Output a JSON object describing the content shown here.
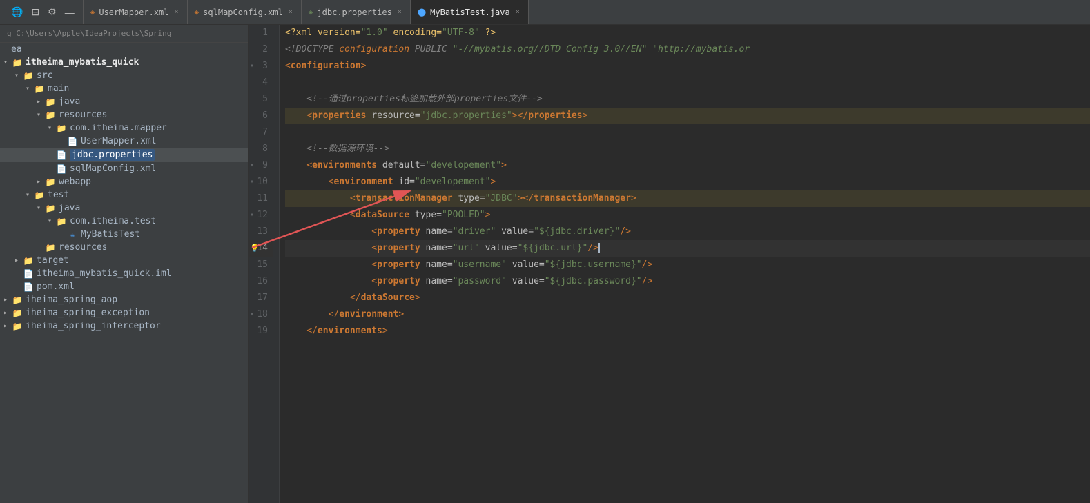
{
  "tabBar": {
    "tabs": [
      {
        "id": "usermapper",
        "label": "UserMapper.xml",
        "type": "xml",
        "active": false
      },
      {
        "id": "sqlmapconfig",
        "label": "sqlMapConfig.xml",
        "type": "xml",
        "active": false
      },
      {
        "id": "jdbc",
        "label": "jdbc.properties",
        "type": "properties",
        "active": false
      },
      {
        "id": "mybatistest",
        "label": "MyBatisTest.java",
        "type": "java",
        "active": true
      }
    ],
    "closeLabel": "×"
  },
  "sidebar": {
    "path": "g C:\\Users\\Apple\\IdeaProjects\\Spring",
    "topLabel": "ea",
    "items": [
      {
        "id": "itheima-mybatis",
        "label": "itheima_mybatis_quick",
        "level": 0,
        "type": "folder",
        "open": true,
        "bold": true
      },
      {
        "id": "src",
        "label": "src",
        "level": 1,
        "type": "folder",
        "open": true
      },
      {
        "id": "main",
        "label": "main",
        "level": 2,
        "type": "folder",
        "open": true
      },
      {
        "id": "java1",
        "label": "java",
        "level": 3,
        "type": "folder",
        "open": false
      },
      {
        "id": "resources",
        "label": "resources",
        "level": 3,
        "type": "folder",
        "open": true
      },
      {
        "id": "com-itheima-mapper",
        "label": "com.itheima.mapper",
        "level": 4,
        "type": "folder",
        "open": true
      },
      {
        "id": "usermapper-xml",
        "label": "UserMapper.xml",
        "level": 5,
        "type": "xml"
      },
      {
        "id": "jdbc-properties",
        "label": "jdbc.properties",
        "level": 4,
        "type": "properties",
        "selected": true
      },
      {
        "id": "sqlmapconfig-xml",
        "label": "sqlMapConfig.xml",
        "level": 4,
        "type": "xml"
      },
      {
        "id": "webapp",
        "label": "webapp",
        "level": 3,
        "type": "folder",
        "open": false
      },
      {
        "id": "test",
        "label": "test",
        "level": 2,
        "type": "folder",
        "open": true
      },
      {
        "id": "java2",
        "label": "java",
        "level": 3,
        "type": "folder",
        "open": true
      },
      {
        "id": "com-itheima-test",
        "label": "com.itheima.test",
        "level": 4,
        "type": "folder",
        "open": true
      },
      {
        "id": "mybatistest-java",
        "label": "MyBatisTest",
        "level": 5,
        "type": "java"
      },
      {
        "id": "resources2",
        "label": "resources",
        "level": 3,
        "type": "folder"
      },
      {
        "id": "target",
        "label": "target",
        "level": 1,
        "type": "folder",
        "open": false
      },
      {
        "id": "itheima-iml",
        "label": "itheima_mybatis_quick.iml",
        "level": 1,
        "type": "iml"
      },
      {
        "id": "pom-xml",
        "label": "pom.xml",
        "level": 1,
        "type": "xml"
      },
      {
        "id": "itheima-spring-aop",
        "label": "iheima_spring_aop",
        "level": 0,
        "type": "folder"
      },
      {
        "id": "itheima-spring-exception",
        "label": "iheima_spring_exception",
        "level": 0,
        "type": "folder"
      },
      {
        "id": "itheima-spring-interceptor",
        "label": "iheima_spring_interceptor",
        "level": 0,
        "type": "folder"
      }
    ]
  },
  "editor": {
    "filename": "sqlMapConfig.xml",
    "lines": [
      {
        "num": 1,
        "fold": false,
        "highlight": "",
        "content": "<?xml version=\"1.0\" encoding=\"UTF-8\" ?>",
        "tokens": [
          {
            "t": "decl",
            "v": "<?xml version=\"1.0\" encoding=\"UTF-8\" ?>"
          }
        ]
      },
      {
        "num": 2,
        "fold": false,
        "highlight": "",
        "content": "<!DOCTYPE configuration PUBLIC \"-//mybatis.org//DTD Config 3.0//EN\" \"http://mybatis.or"
      },
      {
        "num": 3,
        "fold": true,
        "highlight": "",
        "content": "<configuration>"
      },
      {
        "num": 4,
        "fold": false,
        "highlight": "",
        "content": ""
      },
      {
        "num": 5,
        "fold": false,
        "highlight": "",
        "content": "    <!--通过properties标签加载外部properties文件-->"
      },
      {
        "num": 6,
        "fold": false,
        "highlight": "yellow",
        "content": "    <properties resource=\"jdbc.properties\"></properties>"
      },
      {
        "num": 7,
        "fold": false,
        "highlight": "",
        "content": ""
      },
      {
        "num": 8,
        "fold": false,
        "highlight": "",
        "content": "    <!--数据源环境-->"
      },
      {
        "num": 9,
        "fold": true,
        "highlight": "",
        "content": "    <environments default=\"developement\">"
      },
      {
        "num": 10,
        "fold": true,
        "highlight": "",
        "content": "        <environment id=\"developement\">"
      },
      {
        "num": 11,
        "fold": false,
        "highlight": "yellow",
        "content": "            <transactionManager type=\"JDBC\"></transactionManager>"
      },
      {
        "num": 12,
        "fold": true,
        "highlight": "",
        "content": "            <dataSource type=\"POOLED\">"
      },
      {
        "num": 13,
        "fold": false,
        "highlight": "",
        "content": "                <property name=\"driver\" value=\"${jdbc.driver}\"/>"
      },
      {
        "num": 14,
        "fold": false,
        "highlight": "blue",
        "content": "                <property name=\"url\" value=\"${jdbc.url}\"/>",
        "cursor": true
      },
      {
        "num": 15,
        "fold": false,
        "highlight": "",
        "content": "                <property name=\"username\" value=\"${jdbc.username}\"/>"
      },
      {
        "num": 16,
        "fold": false,
        "highlight": "",
        "content": "                <property name=\"password\" value=\"${jdbc.password}\"/>"
      },
      {
        "num": 17,
        "fold": false,
        "highlight": "",
        "content": "            </dataSource>"
      },
      {
        "num": 18,
        "fold": true,
        "highlight": "",
        "content": "        </environment>"
      },
      {
        "num": 19,
        "fold": false,
        "highlight": "",
        "content": "    </environments>"
      }
    ]
  }
}
